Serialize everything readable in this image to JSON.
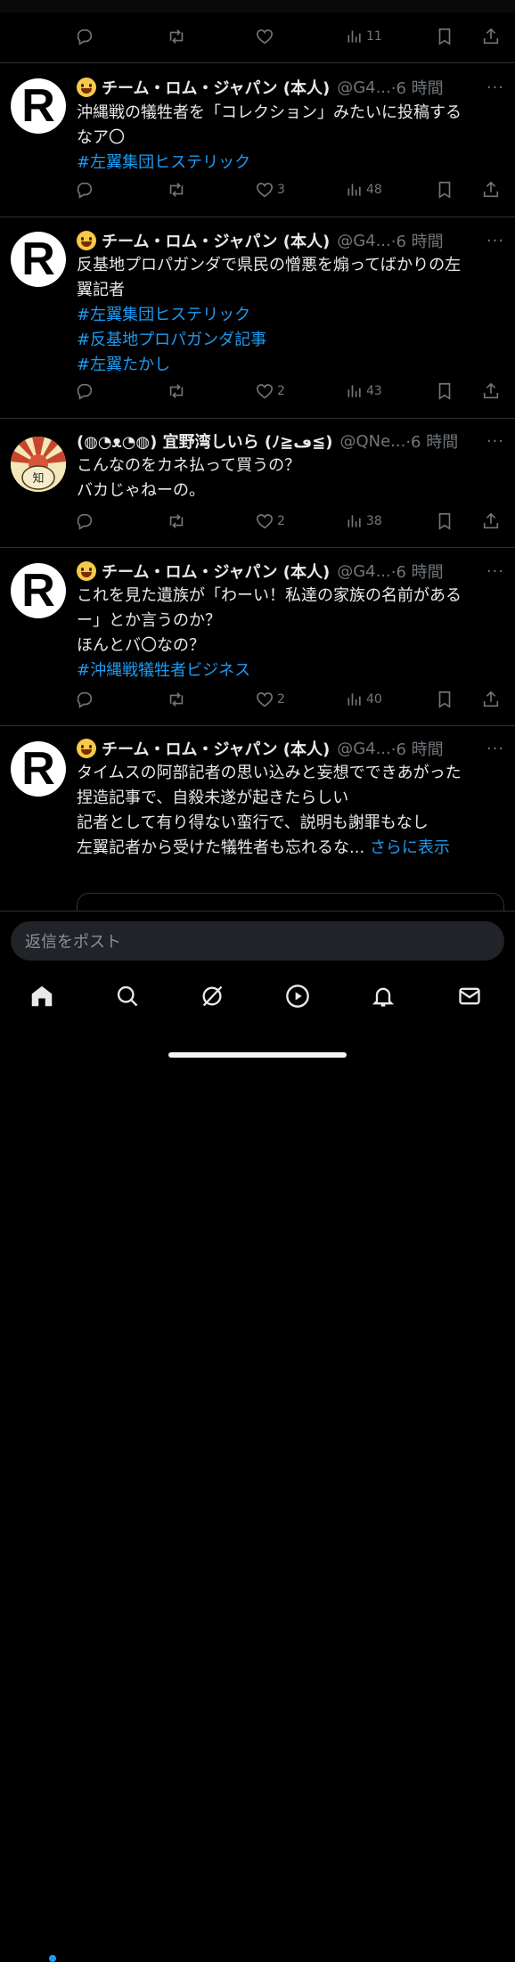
{
  "top_actions": {
    "views": "11"
  },
  "posts": [
    {
      "name": "チーム・ロム・ジャパン (本人)",
      "handle": "@G4...",
      "time": "·6 時間",
      "avatar_letter": "R",
      "text": "沖縄戦の犠牲者を「コレクション」みたいに投稿する\nなア〇",
      "tags": "#左翼集団ヒステリック",
      "likes": "3",
      "views": "48"
    },
    {
      "name": "チーム・ロム・ジャパン (本人)",
      "handle": "@G4...",
      "time": "·6 時間",
      "avatar_letter": "R",
      "text": "反基地プロパガンダで県民の憎悪を煽ってばかりの左\n翼記者",
      "tags": "#左翼集団ヒステリック\n#反基地プロパガンダ記事\n#左翼たかし",
      "likes": "2",
      "views": "43"
    },
    {
      "name": "(◍◔ᴥ◔◍) 宜野湾しいら (ﾉ≧ڡ≦)",
      "handle": "@QNe...",
      "time": "·6 時間",
      "avatar_text": "知",
      "text": "こんなのをカネ払って買うの？\nバカじゃねーの。",
      "likes": "2",
      "views": "38"
    },
    {
      "name": "チーム・ロム・ジャパン (本人)",
      "handle": "@G4...",
      "time": "·6 時間",
      "avatar_letter": "R",
      "text": "これを見た遺族が「わーい！私達の家族の名前がある\nー」とか言うのか？\nほんとバ〇なの？",
      "tags": "#沖縄戦犠牲者ビジネス",
      "likes": "2",
      "views": "40"
    },
    {
      "name": "チーム・ロム・ジャパン (本人)",
      "handle": "@G4...",
      "time": "·6 時間",
      "avatar_letter": "R",
      "text": "タイムスの阿部記者の思い込みと妄想でできあがった\n捏造記事で、自殺未遂が起きたらしい\n記者として有り得ない蛮行で、説明も謝罪もなし\n左翼記者から受けた犠牲者も忘れるな...",
      "show_more": " さらに表示"
    }
  ],
  "reply_placeholder": "返信をポスト",
  "more_label": "···",
  "colors": {
    "link": "#1d9bf0",
    "muted": "#71767b",
    "background": "#000000"
  },
  "nav_icons": [
    "home-icon",
    "search-icon",
    "grok-icon",
    "video-icon",
    "notifications-icon",
    "messages-icon"
  ]
}
